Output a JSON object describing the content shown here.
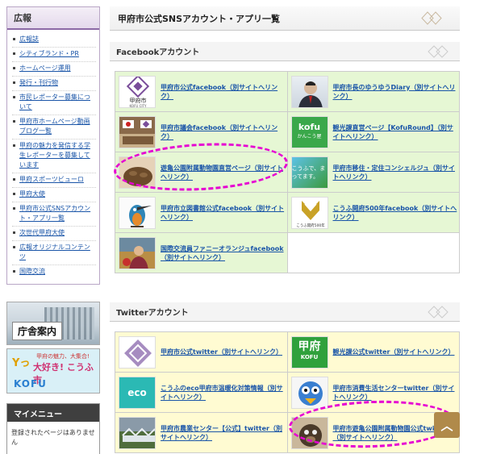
{
  "sidebar": {
    "title": "広報",
    "items": [
      {
        "label": "広報誌"
      },
      {
        "label": "シティブランド・PR"
      },
      {
        "label": "ホームページ運用"
      },
      {
        "label": "発行・刊行物"
      },
      {
        "label": "市民レポーター募集について"
      },
      {
        "label": "甲府市ホームページ動画ブログ一覧"
      },
      {
        "label": "甲府の魅力を発信する学生レポーターを募集しています"
      },
      {
        "label": "甲府スポーツビューロ"
      },
      {
        "label": "甲府大使"
      },
      {
        "label": "甲府市公式SNSアカウント・アプリ一覧"
      },
      {
        "label": "次世代甲府大使"
      },
      {
        "label": "広報オリジナルコンテンツ"
      },
      {
        "label": "国際交流"
      }
    ],
    "banner_chosha": "庁舎案内",
    "banner_kofu": {
      "line1": "Yっ",
      "line2": "甲府の魅力、大集合!",
      "line3": "大好き! こうふ市",
      "line4": "KOFU"
    },
    "mymenu": {
      "title": "マイメニュー",
      "body": "登録されたページはありません"
    }
  },
  "main": {
    "page_title": "甲府市公式SNSアカウント・アプリ一覧",
    "facebook": {
      "heading": "Facebookアカウント",
      "cells": [
        {
          "link": "甲府市公式facebook（別サイトへリンク）",
          "thumb_text": "甲府市",
          "thumb_sub": "KOFU CITY"
        },
        {
          "link": "甲府市長のゆうゆうDiary（別サイトへリンク）"
        },
        {
          "link": "甲府市議会facebook（別サイトへリンク）"
        },
        {
          "link": "観光課直営ページ【KofuRound】（別サイトへリンク）",
          "thumb_text": "kofu",
          "thumb_sub": "かんこう屋"
        },
        {
          "link": "遊亀公園附属動物園直営ページ（別サイトへリンク）"
        },
        {
          "link": "甲府市移住・定住コンシェルジュ（別サイトへリンク）",
          "thumb_text": "こうふで、まってます。"
        },
        {
          "link": "甲府市立図書館公式facebook（別サイトへリンク）"
        },
        {
          "link": "こうふ開府500年facebook（別サイトへリンク）",
          "thumb_text": "こうふ開府500年"
        },
        {
          "link": "国際交流員ファニーオランジュfacebook（別サイトへリンク）"
        }
      ]
    },
    "twitter": {
      "heading": "Twitterアカウント",
      "cells": [
        {
          "link": "甲府市公式twitter（別サイトへリンク）"
        },
        {
          "link": "観光課公式twitter（別サイトへリンク）",
          "thumb_text": "甲府",
          "thumb_sub": "KOFU"
        },
        {
          "link": "こうふのeco甲府市温暖化対策情報（別サイトへリンク）",
          "thumb_text": "eco"
        },
        {
          "link": "甲府市消費生活センターtwitter（別サイトへリンク）"
        },
        {
          "link": "甲府市農業センター【公式】twitter（別サイトへリンク）"
        },
        {
          "link": "甲府市遊亀公園附属動物園公式twitter（別サイトへリンク）"
        }
      ]
    }
  },
  "colors": {
    "annotation": "#e600d2",
    "link": "#1a55a8",
    "fb_cell": "#e6f7d4",
    "tw_cell": "#fffbd2",
    "sidebar_accent": "#8c6aa6"
  },
  "icons": {
    "scroll_top": "chevron-up-icon"
  },
  "scroll_top_glyph": "︿"
}
